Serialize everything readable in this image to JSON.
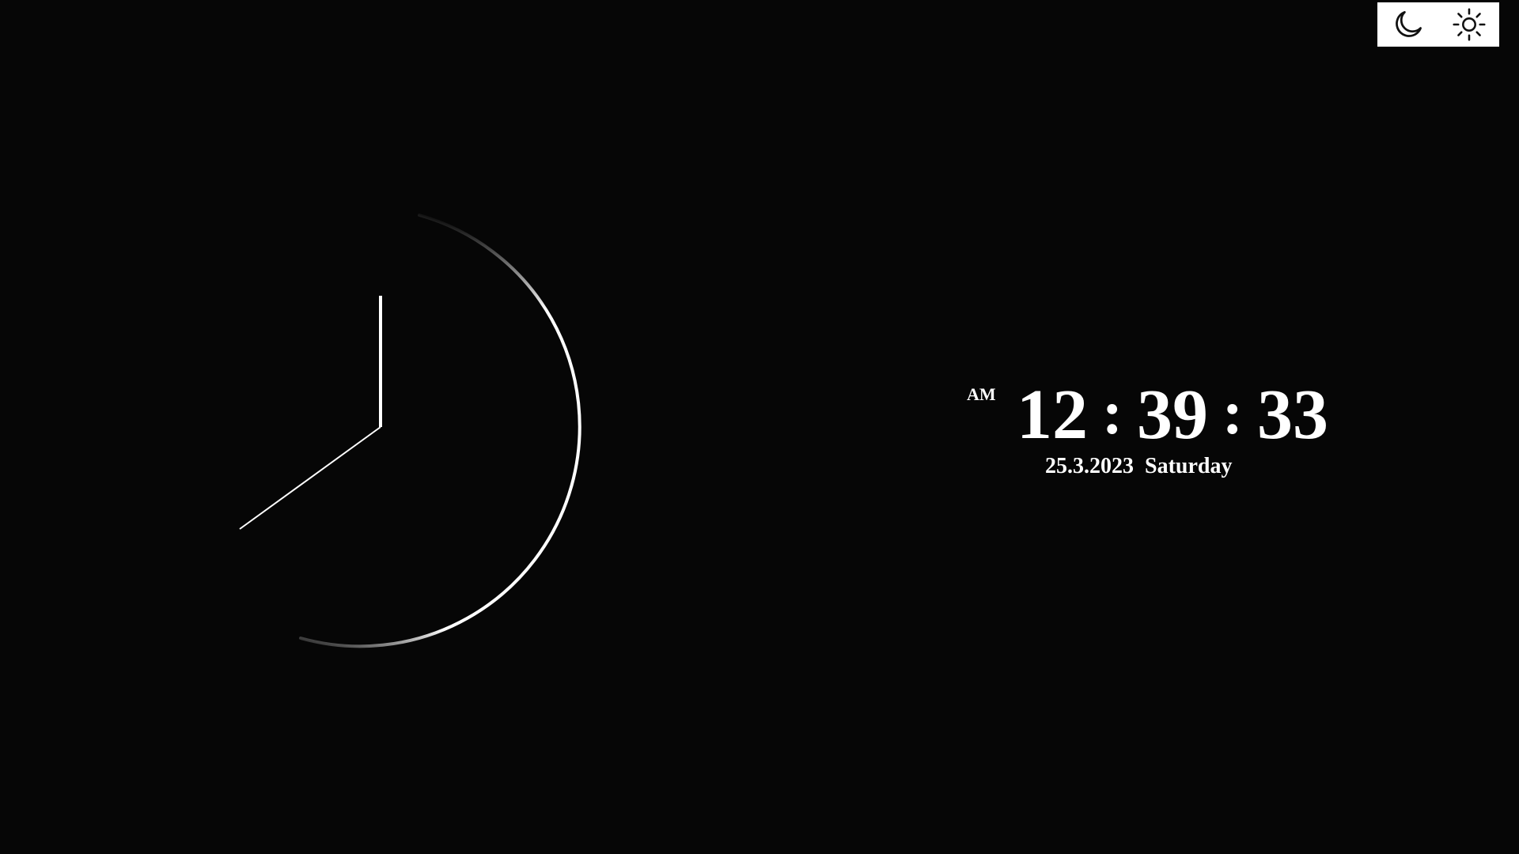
{
  "theme_toggle": {
    "dark_icon": "moon-icon",
    "light_icon": "sun-icon"
  },
  "digital": {
    "meridiem": "AM",
    "hours": "12",
    "minutes": "39",
    "seconds": "33",
    "separator": ":",
    "date": "25.3.2023",
    "weekday": "Saturday"
  },
  "colors": {
    "background": "#060606",
    "foreground": "#ffffff",
    "toggle_bg": "#ffffff",
    "icon": "#111111"
  }
}
